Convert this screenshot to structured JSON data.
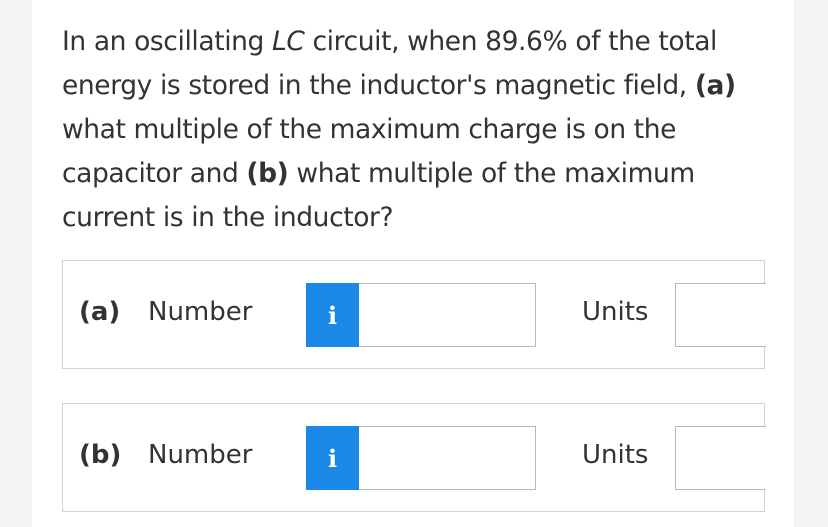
{
  "question": {
    "text_1": "In an oscillating ",
    "lc": "LC",
    "text_2": " circuit, when 89.6% of the total energy is stored in the inductor's magnetic field, ",
    "part_a": "(a)",
    "text_3": " what multiple of the maximum charge is on the capacitor and ",
    "part_b": "(b)",
    "text_4": " what multiple of the maximum current is in the inductor?"
  },
  "answers": [
    {
      "part_label": "(a)",
      "number_label": "Number",
      "info_icon": "i",
      "number_value": "",
      "units_label": "Units",
      "units_value": ""
    },
    {
      "part_label": "(b)",
      "number_label": "Number",
      "info_icon": "i",
      "number_value": "",
      "units_label": "Units",
      "units_value": ""
    }
  ],
  "colors": {
    "info_button": "#1a88e6",
    "text": "#333333",
    "border": "#d3d3d3"
  }
}
